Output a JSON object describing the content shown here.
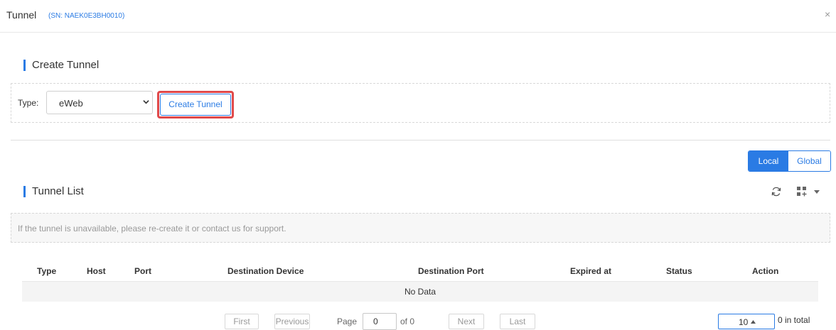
{
  "header": {
    "title": "Tunnel",
    "sn": "(SN: NAEK0E3BH0010)",
    "close": "×"
  },
  "create_section": {
    "title": "Create Tunnel",
    "type_label": "Type:",
    "type_value": "eWeb",
    "create_button": "Create Tunnel"
  },
  "scope_toggle": {
    "local": "Local",
    "global": "Global",
    "selected": "Local"
  },
  "list_section": {
    "title": "Tunnel List",
    "notice": "If the tunnel is unavailable, please re-create it or contact us for support."
  },
  "table": {
    "columns": [
      "Type",
      "Host",
      "Port",
      "Destination Device",
      "Destination Port",
      "Expired at",
      "Status",
      "Action"
    ],
    "empty_text": "No Data"
  },
  "pagination": {
    "first": "First",
    "previous": "Previous",
    "page_label": "Page",
    "page_value": "0",
    "of_label": "of 0",
    "next": "Next",
    "last": "Last",
    "page_size": "10",
    "total": "0 in total"
  },
  "colors": {
    "accent": "#2a7be4",
    "highlight": "#e0494a"
  },
  "icons": [
    "close-icon",
    "chevron-down-icon",
    "refresh-icon",
    "column-settings-icon",
    "caret-down-icon",
    "caret-up-icon"
  ]
}
